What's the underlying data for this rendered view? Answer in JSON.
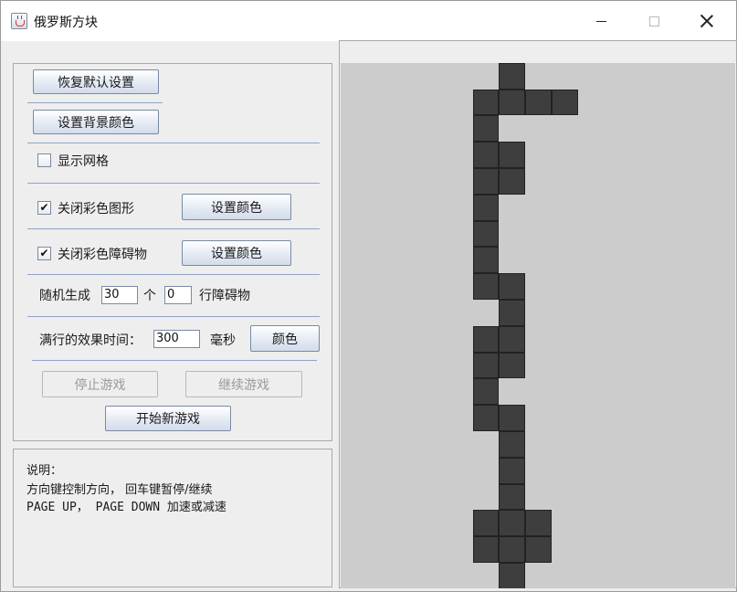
{
  "window": {
    "title": "俄罗斯方块",
    "icons": {
      "app": "java-cup-icon",
      "minimize": "minimize-icon",
      "maximize": "maximize-icon",
      "close": "close-icon"
    }
  },
  "settings": {
    "restore_defaults": "恢复默认设置",
    "set_background_color": "设置背景颜色",
    "show_grid": {
      "label": "显示网格",
      "checked": false
    },
    "close_colored_shapes": {
      "label": "关闭彩色图形",
      "checked": true,
      "check_mark": "✔",
      "button": "设置颜色"
    },
    "close_colored_obstacles": {
      "label": "关闭彩色障碍物",
      "checked": true,
      "check_mark": "✔",
      "button": "设置颜色"
    },
    "random_obstacles": {
      "prefix": "随机生成",
      "count": "30",
      "unit": "个",
      "rows": "0",
      "suffix": "行障碍物"
    },
    "line_clear_effect": {
      "label": "满行的效果时间：",
      "value": "300",
      "unit": "毫秒",
      "color_button": "颜色"
    },
    "stop_game": "停止游戏",
    "continue_game": "继续游戏",
    "new_game": "开始新游戏"
  },
  "help": {
    "heading": "说明：",
    "line1": "方向键控制方向， 回车键暂停/继续",
    "line2": "PAGE UP， PAGE DOWN 加速或减速"
  },
  "board": {
    "background": "#cccccc",
    "block_color": "#3e3e3e",
    "columns": 15,
    "cells": [
      [
        6,
        0
      ],
      [
        5,
        1
      ],
      [
        6,
        1
      ],
      [
        7,
        1
      ],
      [
        8,
        1
      ],
      [
        5,
        2
      ],
      [
        5,
        3
      ],
      [
        6,
        3
      ],
      [
        5,
        4
      ],
      [
        6,
        4
      ],
      [
        5,
        5
      ],
      [
        5,
        6
      ],
      [
        5,
        7
      ],
      [
        5,
        8
      ],
      [
        6,
        8
      ],
      [
        6,
        9
      ],
      [
        5,
        10
      ],
      [
        6,
        10
      ],
      [
        5,
        11
      ],
      [
        6,
        11
      ],
      [
        5,
        12
      ],
      [
        5,
        13
      ],
      [
        6,
        13
      ],
      [
        6,
        14
      ],
      [
        6,
        15
      ],
      [
        6,
        16
      ],
      [
        5,
        17
      ],
      [
        6,
        17
      ],
      [
        7,
        17
      ],
      [
        5,
        18
      ],
      [
        6,
        18
      ],
      [
        7,
        18
      ],
      [
        6,
        19
      ]
    ]
  }
}
